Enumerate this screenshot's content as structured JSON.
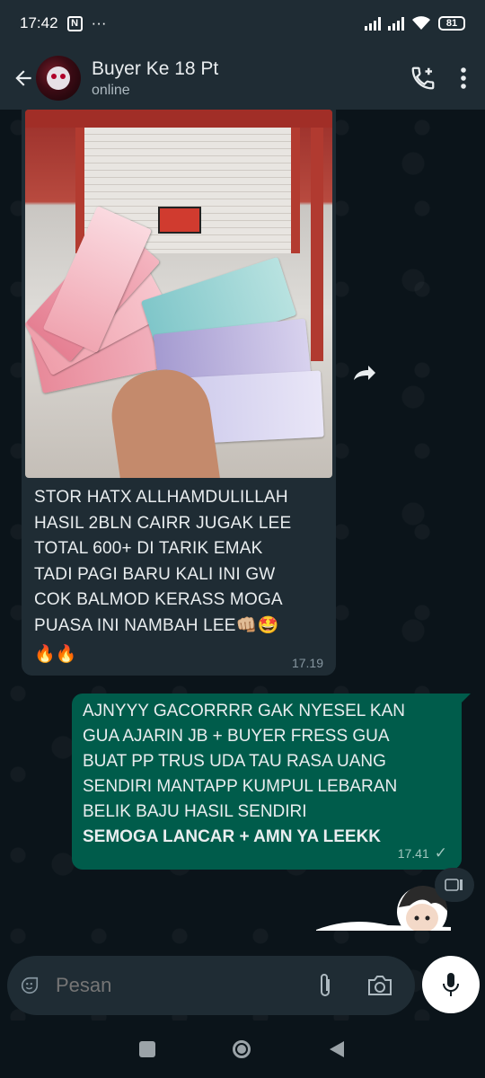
{
  "status_bar": {
    "time": "17:42",
    "menu_dots": "···",
    "battery": "81",
    "nfc_icon_label": "N"
  },
  "header": {
    "contact_name": "Buyer Ke 18 Pt",
    "status": "online",
    "icons": [
      "back-arrow-icon",
      "add-call-icon",
      "more-vert-icon"
    ]
  },
  "messages": [
    {
      "direction": "incoming",
      "has_image": true,
      "lines": [
        "STOR HATX ALLHAMDULILLAH",
        "HASIL 2BLN CAIRR JUGAK LEE",
        "TOTAL 600+ DI TARIK EMAK",
        "TADI PAGI BARU KALI INI GW",
        "COK BALMOD KERASS MOGA",
        "PUASA INI NAMBAH LEE"
      ],
      "emoji_inline": "👊🏼🤩",
      "emoji_row": "🔥🔥",
      "time": "17.19"
    },
    {
      "direction": "outgoing",
      "lines": [
        "AJNYYY GACORRRR GAK NYESEL KAN",
        "GUA AJARIN JB + BUYER FRESS GUA",
        "BUAT PP TRUS UDA TAU RASA UANG",
        "SENDIRI MANTAPP KUMPUL LEBARAN",
        "BELIK BAJU HASIL SENDIRI"
      ],
      "bold_line": "SEMOGA LANCAR + AMN YA LEEKK",
      "time": "17.41",
      "tick": "✓"
    }
  ],
  "input": {
    "placeholder": "Pesan"
  },
  "colors": {
    "header_bg": "#1f2c34",
    "chat_bg": "#0b141a",
    "incoming_bubble": "#1f2c34",
    "outgoing_bubble": "#005c4b"
  }
}
